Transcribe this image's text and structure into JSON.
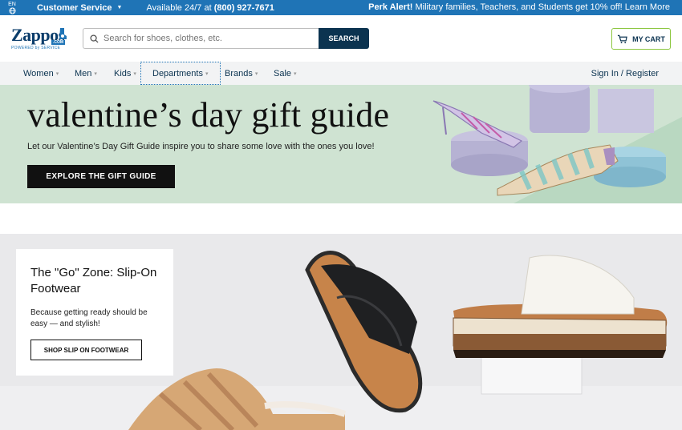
{
  "topbar": {
    "lang": "EN",
    "customer_service": "Customer Service",
    "availability_prefix": "Available 24/7 at ",
    "phone": "(800) 927-7671",
    "perk_title": "Perk Alert!",
    "perk_text": " Military families, Teachers, and Students get 10% off! Learn More"
  },
  "header": {
    "logo_word": "Zappos",
    "logo_tag": "POWERED by SERVICE",
    "logo_badge": ".COM",
    "search_placeholder": "Search for shoes, clothes, etc.",
    "search_button": "SEARCH",
    "cart_label": "MY CART"
  },
  "nav": {
    "items": [
      "Women",
      "Men",
      "Kids",
      "Departments",
      "Brands",
      "Sale"
    ],
    "signin": "Sign In / Register"
  },
  "hero1": {
    "title": "valentine’s day gift guide",
    "subtitle": "Let our Valentine’s Day Gift Guide inspire you to share some love with the ones you love!",
    "cta": "EXPLORE THE GIFT GUIDE"
  },
  "hero2": {
    "title": "The \"Go\" Zone: Slip-On Footwear",
    "body": "Because getting ready should be easy — and stylish!",
    "cta": "SHOP SLIP ON FOOTWEAR"
  },
  "colors": {
    "brand_blue": "#1f74b6",
    "navy": "#0b3350",
    "cart_border": "#8cc63f",
    "hero1_bg": "#cfe3d2",
    "hero2_bg": "#e9e9eb"
  }
}
